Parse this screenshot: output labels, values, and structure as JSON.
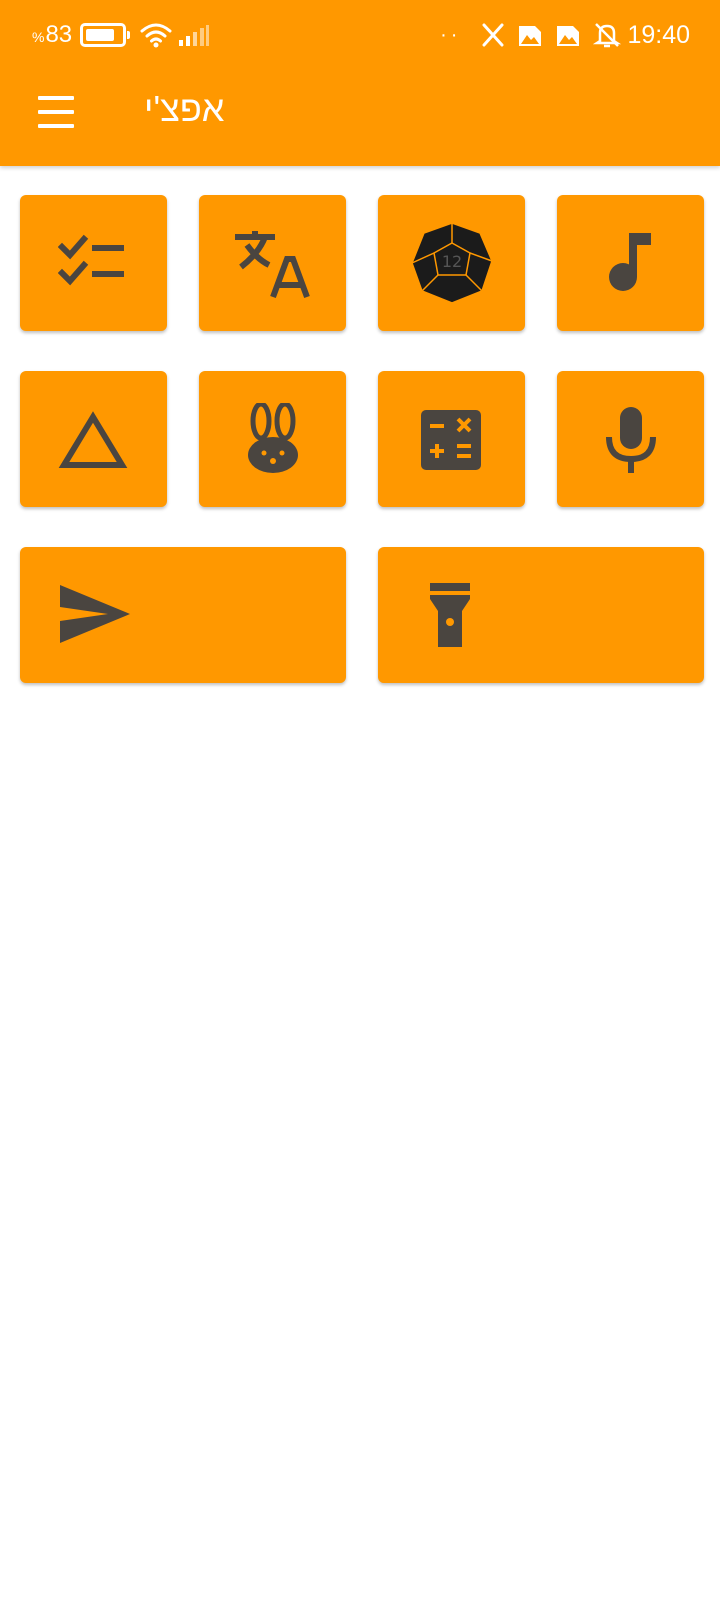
{
  "status_bar": {
    "battery_percent": "83",
    "percent_sign": "%",
    "dots": "··",
    "time": "19:40",
    "x_app_icon": "x-logo-icon"
  },
  "toolbar": {
    "title": "אפצ'י",
    "menu_icon": "hamburger-menu-icon"
  },
  "tiles": [
    {
      "icon": "checklist-icon"
    },
    {
      "icon": "translate-icon"
    },
    {
      "icon": "d12-dice-icon",
      "dice_number": "12"
    },
    {
      "icon": "music-note-icon"
    },
    {
      "icon": "triangle-icon"
    },
    {
      "icon": "rabbit-icon"
    },
    {
      "icon": "calculator-icon"
    },
    {
      "icon": "microphone-icon"
    },
    {
      "icon": "send-icon"
    },
    {
      "icon": "flashlight-icon"
    }
  ],
  "colors": {
    "primary": "#ff9800",
    "icon": "#4a4540",
    "background": "#ffffff"
  }
}
